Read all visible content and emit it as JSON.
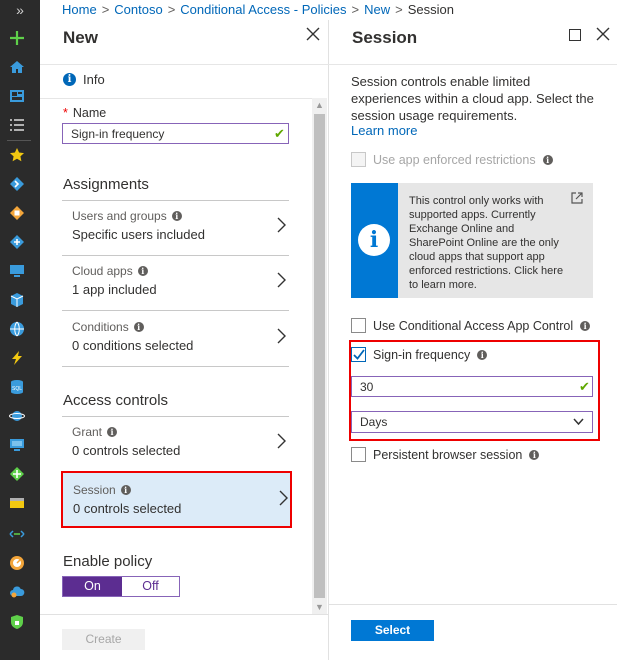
{
  "breadcrumb": [
    {
      "label": "Home"
    },
    {
      "label": "Contoso"
    },
    {
      "label": "Conditional Access - Policies"
    },
    {
      "label": "New"
    }
  ],
  "breadcrumb_current": "Session",
  "breadcrumb_separator": ">",
  "rail": {
    "expand_label": "»",
    "icons": [
      "create-resource-icon",
      "home-icon",
      "dashboard-icon",
      "all-services-icon",
      "favorites-star-icon",
      "devops-icon",
      "resource-group-icon",
      "app-service-icon",
      "monitor-icon",
      "cube-icon",
      "globe-icon",
      "function-icon",
      "sql-database-icon",
      "cosmos-db-icon",
      "virtual-machine-icon",
      "load-balancer-icon",
      "storage-icon",
      "virtual-network-icon",
      "advisor-icon",
      "cloud-icon",
      "security-center-icon"
    ]
  },
  "new_blade": {
    "title": "New",
    "info_label": "Info",
    "name_label": "Name",
    "name_required": "*",
    "name_value": "Sign-in frequency",
    "assignments_title": "Assignments",
    "items": [
      {
        "title": "Users and groups",
        "value": "Specific users included"
      },
      {
        "title": "Cloud apps",
        "value": "1 app included"
      },
      {
        "title": "Conditions",
        "value": "0 conditions selected"
      }
    ],
    "access_controls_title": "Access controls",
    "grant": {
      "title": "Grant",
      "value": "0 controls selected"
    },
    "session": {
      "title": "Session",
      "value": "0 controls selected"
    },
    "enable_policy_title": "Enable policy",
    "toggle_on": "On",
    "toggle_off": "Off",
    "create_label": "Create"
  },
  "session_blade": {
    "title": "Session",
    "description": "Session controls enable limited experiences within a cloud app. Select the session usage requirements.",
    "learn_more": "Learn more",
    "app_enforced_label": "Use app enforced restrictions",
    "notice_text": "This control only works with supported apps. Currently Exchange Online and SharePoint Online are the only cloud apps that support app enforced restrictions. Click here to learn more.",
    "cas_label": "Use Conditional Access App Control",
    "signin_freq_label": "Sign-in frequency",
    "signin_freq_checked": true,
    "freq_value": "30",
    "freq_unit": "Days",
    "persistent_label": "Persistent browser session",
    "select_label": "Select"
  },
  "colors": {
    "accent_purple": "#5c2d91",
    "field_border": "#8764b8",
    "link_blue": "#0067b8",
    "primary_button": "#0078d4",
    "highlight_red": "#e00000",
    "session_bg": "#dcebf8",
    "valid_check": "#5fa800"
  }
}
